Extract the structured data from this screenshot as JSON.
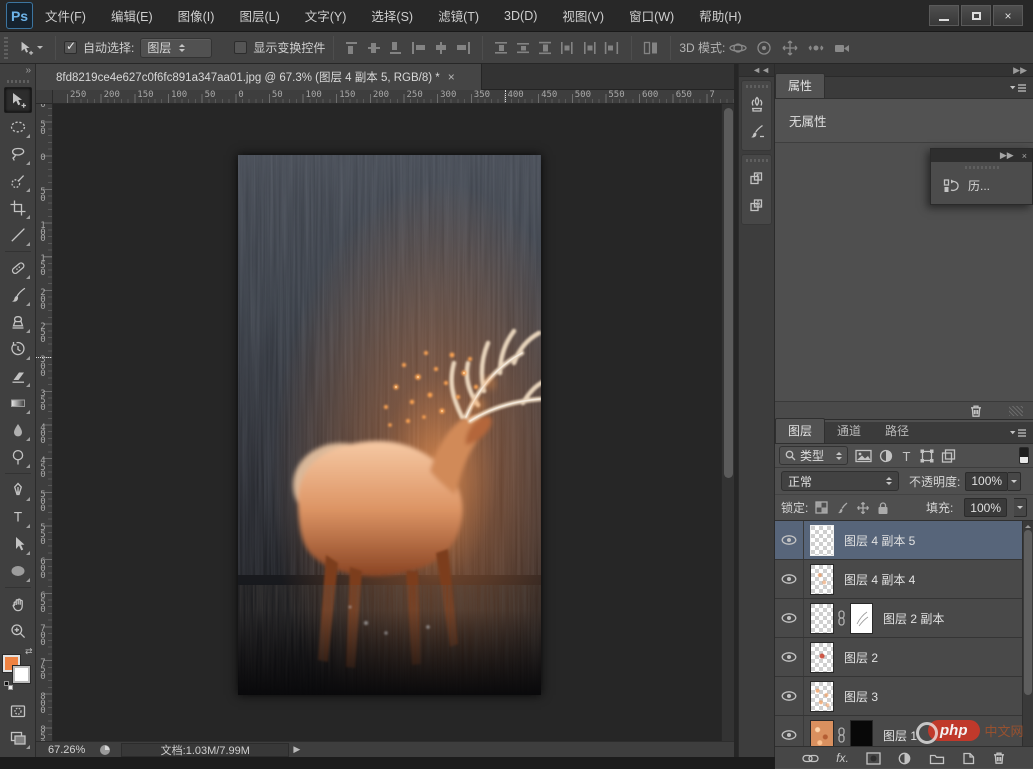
{
  "titlebar": {
    "logo": "Ps",
    "menus": [
      "文件(F)",
      "编辑(E)",
      "图像(I)",
      "图层(L)",
      "文字(Y)",
      "选择(S)",
      "滤镜(T)",
      "3D(D)",
      "视图(V)",
      "窗口(W)",
      "帮助(H)"
    ],
    "close_glyph": "×"
  },
  "options_bar": {
    "auto_select_label": "自动选择:",
    "auto_select_value": "图层",
    "show_transform_label": "显示变换控件",
    "mode_3d_label": "3D 模式:"
  },
  "document": {
    "tab_title": "8fd8219ce4e627c0f6fc891a347aa01.jpg @ 67.3% (图层 4 副本 5, RGB/8) *",
    "close_glyph": "×",
    "image_alt": "发光的麋鹿站在夜色草丛中"
  },
  "rulers": {
    "horizontal": [
      "250",
      "200",
      "150",
      "100",
      "50",
      "0",
      "50",
      "100",
      "150",
      "200",
      "250",
      "300",
      "350",
      "400",
      "450",
      "500",
      "550",
      "600",
      "650",
      "7"
    ],
    "vertical": [
      "100",
      "50",
      "0",
      "50",
      "100",
      "150",
      "200",
      "250",
      "300",
      "350",
      "400",
      "450",
      "500",
      "550",
      "600",
      "650",
      "700",
      "750",
      "800",
      "850"
    ]
  },
  "toolbar": {
    "tools": [
      "move",
      "elliptical-marquee",
      "lasso",
      "quick-selection",
      "crop",
      "eyedropper",
      "spot-healing-brush",
      "brush",
      "clone-stamp",
      "history-brush",
      "eraser",
      "gradient",
      "smudge",
      "dodge",
      "pen",
      "type",
      "path-selection",
      "ellipse-shape",
      "hand",
      "zoom"
    ],
    "foreground_color": "#ef8342",
    "background_color": "#ffffff",
    "collapse_glyph": "»"
  },
  "panels": {
    "collapse_glyph": "◄◄",
    "expand_glyph": "▶▶",
    "properties": {
      "tab": "属性",
      "content": "无属性"
    },
    "history_float": {
      "label": "历...",
      "close_glyph": "×"
    },
    "layers": {
      "tabs": [
        "图层",
        "通道",
        "路径"
      ],
      "filter_label": "类型",
      "blend_mode": "正常",
      "opacity_label": "不透明度:",
      "opacity_value": "100%",
      "lock_label": "锁定:",
      "fill_label": "填充:",
      "fill_value": "100%",
      "fx_label": "fx.",
      "items": [
        {
          "name": "图层 4 副本 5",
          "selected": true
        },
        {
          "name": "图层 4 副本 4",
          "selected": false
        },
        {
          "name": "图层 2 副本",
          "selected": false
        },
        {
          "name": "图层 2",
          "selected": false
        },
        {
          "name": "图层 3",
          "selected": false
        },
        {
          "name": "图层 1",
          "selected": false
        }
      ]
    }
  },
  "statusbar": {
    "zoom_value": "67.26%",
    "doc_info": "文档:1.03M/7.99M",
    "arrow_glyph": "▶"
  },
  "watermark": {
    "logo": "php",
    "text": "中文网"
  },
  "colors": {
    "selected_layer_row": "#57657a",
    "foreground_swatch": "#ef8342",
    "titlebar_bg": "#282828",
    "panel_bg": "#4f4f4f",
    "canvas_bg": "#262626"
  }
}
